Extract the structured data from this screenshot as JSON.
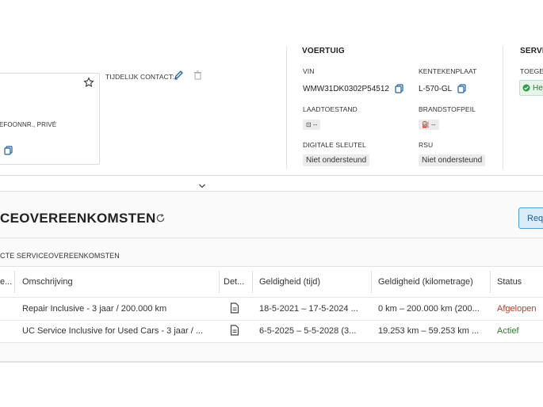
{
  "contact": {
    "temp_contact_label": "TIJDELIJK CONTACT:",
    "phone_private_label": "EFOONNR., PRIVÉ"
  },
  "vehicle": {
    "title": "VOERTUIG",
    "vin_label": "VIN",
    "vin": "WMW31DK0302P54512",
    "plate_label": "KENTEKENPLAAT",
    "plate": "L-570-GL",
    "charge_label": "LAADTOESTAND",
    "charge_value": "⊡ --",
    "fuel_label": "BRANDSTOFPEIL",
    "fuel_value": "⛽ --",
    "digital_key_label": "DIGITALE SLEUTEL",
    "digital_key_value": "Niet ondersteund",
    "rsu_label": "RSU",
    "rsu_value": "Niet ondersteund"
  },
  "service": {
    "title": "SERVIC",
    "sub_label": "TOEGEV",
    "badge": "He"
  },
  "agreements": {
    "title": "CEOVEREENKOMSTEN",
    "subtitle": "CTE SERVICEOVEREENKOMSTEN",
    "request_button": "Requ",
    "columns": [
      "e...",
      "Omschrijving",
      "Det...",
      "Geldigheid (tijd)",
      "Geldigheid (kilometrage)",
      "Status"
    ],
    "rows": [
      {
        "description": "Repair Inclusive - 3 jaar / 200.000 km",
        "validity_time": "18-5-2021 – 17-5-2024 ...",
        "validity_km": "0 km – 200.000 km (200...",
        "status": "Afgelopen",
        "status_color": "#c0392b"
      },
      {
        "description": "UC Service Inclusive for Used Cars - 3 jaar / ...",
        "validity_time": "6-5-2025 – 5-5-2028 (3...",
        "validity_km": "19.253 km – 59.253 km ...",
        "status": "Actief",
        "status_color": "#2e7d32"
      }
    ]
  },
  "colors": {
    "accent_button_bg": "#d9ecf7",
    "accent_button_border": "#4aa0d6",
    "badge_green": "#2e9b4a"
  }
}
